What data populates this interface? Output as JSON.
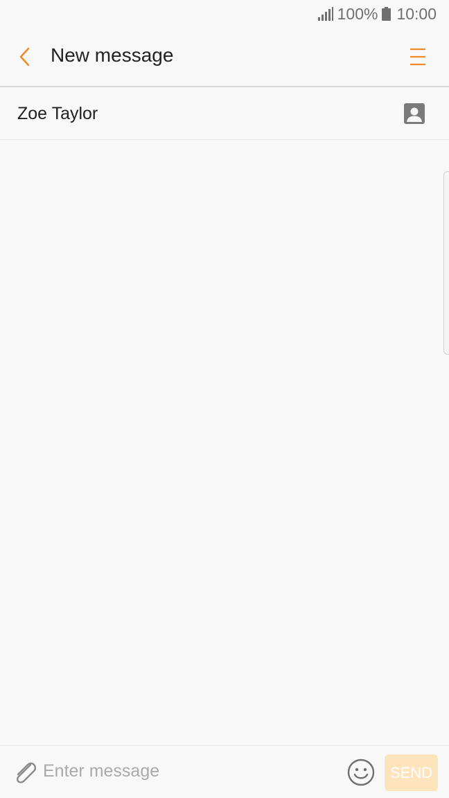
{
  "status_bar": {
    "battery_text": "100%",
    "time": "10:00"
  },
  "app_bar": {
    "title": "New message",
    "back_icon": "chevron-left-icon",
    "menu_icon": "menu-icon"
  },
  "recipient": {
    "name": "Zoe Taylor",
    "contacts_icon": "contact-card-icon"
  },
  "compose": {
    "placeholder": "Enter message",
    "value": "",
    "send_label": "SEND",
    "attach_icon": "paperclip-icon",
    "emoji_icon": "smiley-icon"
  },
  "colors": {
    "accent": "#f08a24",
    "send_disabled_bg": "#fde4bd",
    "background": "#f8f8f8"
  }
}
